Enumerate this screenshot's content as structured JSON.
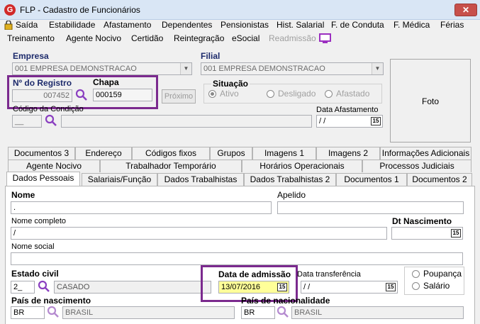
{
  "window": {
    "title": "FLP - Cadastro de Funcionários",
    "icon_letter": "G",
    "close": "✕"
  },
  "menu1": [
    "Saída",
    "Estabilidade",
    "Afastamento",
    "Dependentes",
    "Pensionistas",
    "Hist. Salarial",
    "F. de Conduta",
    "F. Médica",
    "Férias"
  ],
  "menu2": [
    "Treinamento",
    "Agente Nocivo",
    "Certidão",
    "Reintegração",
    "eSocial",
    "Readmissão"
  ],
  "empresa": {
    "label": "Empresa",
    "value": "001 EMPRESA DEMONSTRACAO"
  },
  "filial": {
    "label": "Filial",
    "value": "001 EMPRESA DEMONSTRACAO"
  },
  "registro": {
    "label": "Nº do Registro",
    "value": "007452"
  },
  "chapa": {
    "label": "Chapa",
    "value": "000159"
  },
  "proximo_label": "Próximo",
  "situacao": {
    "label": "Situação",
    "options": [
      "Ativo",
      "Desligado",
      "Afastado"
    ],
    "selected": "Ativo"
  },
  "codigo_condicao": {
    "label": "Código da Condição",
    "value": "__"
  },
  "data_afastamento": {
    "label": "Data Afastamento",
    "value": " /  /"
  },
  "foto_label": "Foto",
  "tabs_row1": [
    "Documentos 3",
    "Endereço",
    "Códigos fixos",
    "Grupos",
    "Imagens 1",
    "Imagens 2",
    "Informações Adicionais"
  ],
  "tabs_row2": [
    "Agente Nocivo",
    "Trabalhador Temporário",
    "Horários Operacionais",
    "Processos Judiciais"
  ],
  "tabs_row3": [
    "Dados Pessoais",
    "Salariais/Função",
    "Dados Trabalhistas",
    "Dados Trabalhistas 2",
    "Documentos 1",
    "Documentos 2"
  ],
  "personal": {
    "nome_label": "Nome",
    "nome_value": ".",
    "apelido_label": "Apelido",
    "apelido_value": "",
    "nome_completo_label": "Nome completo",
    "nome_completo_value": "/",
    "dt_nascimento_label": "Dt Nascimento",
    "dt_nascimento_value": "",
    "nome_social_label": "Nome social",
    "nome_social_value": "",
    "estado_civil_label": "Estado civil",
    "estado_civil_code": "2_",
    "estado_civil_desc": "CASADO",
    "data_admissao_label": "Data de admissão",
    "data_admissao_value": "13/07/2016",
    "data_transferencia_label": "Data transferência",
    "data_transferencia_value": " /  /",
    "conta_options": [
      "Poupança",
      "Salário"
    ],
    "pais_nascimento_label": "País de nascimento",
    "pais_nascimento_code": "BR",
    "pais_nascimento_desc": "BRASIL",
    "pais_nacionalidade_label": "País de nacionalidade",
    "pais_nacionalidade_code": "BR",
    "pais_nacionalidade_desc": "BRASIL"
  },
  "colors": {
    "highlight": "#7b2a8e",
    "label_blue": "#1c2a6b",
    "yellow_field": "#ffff99"
  }
}
